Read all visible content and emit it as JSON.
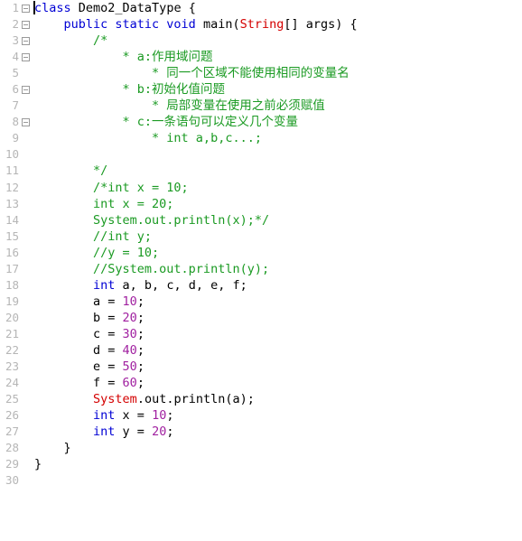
{
  "editor": {
    "background_color": "#ffffff",
    "line_number_color": "#b6b6b6",
    "total_lines": 30,
    "caret_line": 1,
    "caret_column": 1,
    "colors": {
      "keyword": "#0000d4",
      "type": "#d40000",
      "number": "#a020a0",
      "comment": "#1a9a22",
      "plain": "#000000",
      "fold_marker": "#9a9a9a"
    }
  },
  "lines": [
    {
      "number": "1",
      "fold": true,
      "tokens": [
        {
          "t": "class ",
          "k": "kw"
        },
        {
          "t": "Demo2_DataType {",
          "k": "pln"
        }
      ]
    },
    {
      "number": "2",
      "fold": true,
      "tokens": [
        {
          "t": "    ",
          "k": "pln"
        },
        {
          "t": "public static void ",
          "k": "kw"
        },
        {
          "t": "main(",
          "k": "pln"
        },
        {
          "t": "String",
          "k": "type"
        },
        {
          "t": "[] args) {",
          "k": "pln"
        }
      ]
    },
    {
      "number": "3",
      "fold": true,
      "tokens": [
        {
          "t": "        /*",
          "k": "cmt"
        }
      ]
    },
    {
      "number": "4",
      "fold": true,
      "tokens": [
        {
          "t": "            * a:作用域问题",
          "k": "cmt"
        }
      ]
    },
    {
      "number": "5",
      "fold": false,
      "tokens": [
        {
          "t": "                * 同一个区域不能使用相同的变量名",
          "k": "cmt"
        }
      ]
    },
    {
      "number": "6",
      "fold": true,
      "tokens": [
        {
          "t": "            * b:初始化值问题",
          "k": "cmt"
        }
      ]
    },
    {
      "number": "7",
      "fold": false,
      "tokens": [
        {
          "t": "                * 局部变量在使用之前必须赋值",
          "k": "cmt"
        }
      ]
    },
    {
      "number": "8",
      "fold": true,
      "tokens": [
        {
          "t": "            * c:一条语句可以定义几个变量",
          "k": "cmt"
        }
      ]
    },
    {
      "number": "9",
      "fold": false,
      "tokens": [
        {
          "t": "                * int a,b,c...;",
          "k": "cmt"
        }
      ]
    },
    {
      "number": "10",
      "fold": false,
      "tokens": []
    },
    {
      "number": "11",
      "fold": false,
      "tokens": [
        {
          "t": "        */",
          "k": "cmt"
        }
      ]
    },
    {
      "number": "12",
      "fold": false,
      "tokens": [
        {
          "t": "        /*int x = 10;",
          "k": "cmt"
        }
      ]
    },
    {
      "number": "13",
      "fold": false,
      "tokens": [
        {
          "t": "        int x = 20;",
          "k": "cmt"
        }
      ]
    },
    {
      "number": "14",
      "fold": false,
      "tokens": [
        {
          "t": "        System.out.println(x);*/",
          "k": "cmt"
        }
      ]
    },
    {
      "number": "15",
      "fold": false,
      "tokens": [
        {
          "t": "        //int y;",
          "k": "cmt"
        }
      ]
    },
    {
      "number": "16",
      "fold": false,
      "tokens": [
        {
          "t": "        //y = 10;",
          "k": "cmt"
        }
      ]
    },
    {
      "number": "17",
      "fold": false,
      "tokens": [
        {
          "t": "        //System.out.println(y);",
          "k": "cmt"
        }
      ]
    },
    {
      "number": "18",
      "fold": false,
      "tokens": [
        {
          "t": "        ",
          "k": "pln"
        },
        {
          "t": "int",
          "k": "kw"
        },
        {
          "t": " a, b, c, d, e, f;",
          "k": "pln"
        }
      ]
    },
    {
      "number": "19",
      "fold": false,
      "tokens": [
        {
          "t": "        a = ",
          "k": "pln"
        },
        {
          "t": "10",
          "k": "num"
        },
        {
          "t": ";",
          "k": "pln"
        }
      ]
    },
    {
      "number": "20",
      "fold": false,
      "tokens": [
        {
          "t": "        b = ",
          "k": "pln"
        },
        {
          "t": "20",
          "k": "num"
        },
        {
          "t": ";",
          "k": "pln"
        }
      ]
    },
    {
      "number": "21",
      "fold": false,
      "tokens": [
        {
          "t": "        c = ",
          "k": "pln"
        },
        {
          "t": "30",
          "k": "num"
        },
        {
          "t": ";",
          "k": "pln"
        }
      ]
    },
    {
      "number": "22",
      "fold": false,
      "tokens": [
        {
          "t": "        d = ",
          "k": "pln"
        },
        {
          "t": "40",
          "k": "num"
        },
        {
          "t": ";",
          "k": "pln"
        }
      ]
    },
    {
      "number": "23",
      "fold": false,
      "tokens": [
        {
          "t": "        e = ",
          "k": "pln"
        },
        {
          "t": "50",
          "k": "num"
        },
        {
          "t": ";",
          "k": "pln"
        }
      ]
    },
    {
      "number": "24",
      "fold": false,
      "tokens": [
        {
          "t": "        f = ",
          "k": "pln"
        },
        {
          "t": "60",
          "k": "num"
        },
        {
          "t": ";",
          "k": "pln"
        }
      ]
    },
    {
      "number": "25",
      "fold": false,
      "tokens": [
        {
          "t": "        ",
          "k": "pln"
        },
        {
          "t": "System",
          "k": "type"
        },
        {
          "t": ".out.println(a);",
          "k": "pln"
        }
      ]
    },
    {
      "number": "26",
      "fold": false,
      "tokens": [
        {
          "t": "        ",
          "k": "pln"
        },
        {
          "t": "int",
          "k": "kw"
        },
        {
          "t": " x = ",
          "k": "pln"
        },
        {
          "t": "10",
          "k": "num"
        },
        {
          "t": ";",
          "k": "pln"
        }
      ]
    },
    {
      "number": "27",
      "fold": false,
      "tokens": [
        {
          "t": "        ",
          "k": "pln"
        },
        {
          "t": "int",
          "k": "kw"
        },
        {
          "t": " y = ",
          "k": "pln"
        },
        {
          "t": "20",
          "k": "num"
        },
        {
          "t": ";",
          "k": "pln"
        }
      ]
    },
    {
      "number": "28",
      "fold": false,
      "tokens": [
        {
          "t": "    }",
          "k": "pln"
        }
      ]
    },
    {
      "number": "29",
      "fold": false,
      "tokens": [
        {
          "t": "}",
          "k": "pln"
        }
      ]
    },
    {
      "number": "30",
      "fold": false,
      "tokens": []
    }
  ]
}
